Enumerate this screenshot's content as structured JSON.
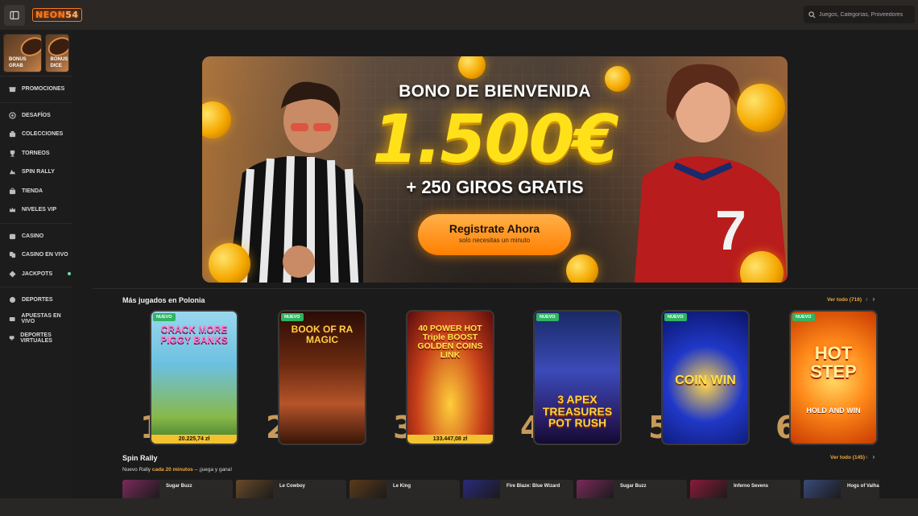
{
  "header": {
    "logo_text": "NEON",
    "logo_num": "54",
    "search_placeholder": "Juegos, Categorías, Proveedores"
  },
  "sidebar": {
    "bonus_cards": [
      {
        "label_line1": "BONUS",
        "label_line2": "GRAB"
      },
      {
        "label_line1": "BONUS",
        "label_line2": "DICE"
      }
    ],
    "groups": [
      [
        {
          "label": "PROMOCIONES",
          "icon": "gift-icon"
        }
      ],
      [
        {
          "label": "DESAFÍOS",
          "icon": "target-icon"
        },
        {
          "label": "COLECCIONES",
          "icon": "collection-icon"
        },
        {
          "label": "TORNEOS",
          "icon": "trophy-icon"
        },
        {
          "label": "SPIN RALLY",
          "icon": "rally-icon"
        },
        {
          "label": "TIENDA",
          "icon": "shop-icon"
        },
        {
          "label": "NIVELES VIP",
          "icon": "crown-icon"
        }
      ],
      [
        {
          "label": "CASINO",
          "icon": "casino-icon"
        },
        {
          "label": "CASINO EN VIVO",
          "icon": "live-casino-icon"
        },
        {
          "label": "JACKPOTS",
          "icon": "jackpot-icon"
        }
      ],
      [
        {
          "label": "DEPORTES",
          "icon": "ball-icon"
        },
        {
          "label": "APUESTAS EN VIVO",
          "icon": "live-bet-icon"
        },
        {
          "label": "DEPORTES VIRTUALES",
          "icon": "virtual-sports-icon"
        }
      ]
    ]
  },
  "hero": {
    "title": "BONO DE BIENVENIDA",
    "amount": "1.500€",
    "subtitle": "+ 250 GIROS GRATIS",
    "cta_label": "Registrate Ahora",
    "cta_sub": "solo necesitas un minuto",
    "jersey_number": "7"
  },
  "most_played": {
    "title": "Más jugados en Polonia",
    "see_all": "Ver todo (716)",
    "games": [
      {
        "rank": "1",
        "badge": "NUEVO",
        "title": "CRACK MORE PIGGY BANKS",
        "price": "20.225,74 zł"
      },
      {
        "rank": "2",
        "badge": "NUEVO",
        "title": "BOOK OF RA MAGIC"
      },
      {
        "rank": "3",
        "title": "40 POWER HOT Triple BOOST GOLDEN COINS LINK",
        "price": "133.447,08 zł"
      },
      {
        "rank": "4",
        "badge": "NUEVO",
        "title": "3 APEX TREASURES POT RUSH"
      },
      {
        "rank": "5",
        "badge": "NUEVO",
        "title": "COIN WIN"
      },
      {
        "rank": "6",
        "badge": "NUEVO",
        "title": "HOT STEP",
        "subtitle": "HOLD AND WIN"
      }
    ]
  },
  "spin_rally": {
    "title": "Spin Rally",
    "see_all": "Ver todo (145)",
    "sub_prefix": "Nuevo Rally",
    "sub_highlight": "cada 20 minutos",
    "sub_suffix": " – ¡juega y gana!",
    "cards": [
      {
        "name": "Sugar Buzz",
        "color": "#7a2a5a"
      },
      {
        "name": "Le Cowboy",
        "color": "#6a4a2a"
      },
      {
        "name": "Le King",
        "color": "#5a3a1a"
      },
      {
        "name": "Fire Blaze: Blue Wizard",
        "color": "#2a2a7a"
      },
      {
        "name": "Sugar Buzz",
        "color": "#7a2a5a"
      },
      {
        "name": "Inferno Sevens",
        "color": "#8a1a3a"
      },
      {
        "name": "Hogs of Valhal",
        "color": "#3a4a7a"
      }
    ]
  }
}
